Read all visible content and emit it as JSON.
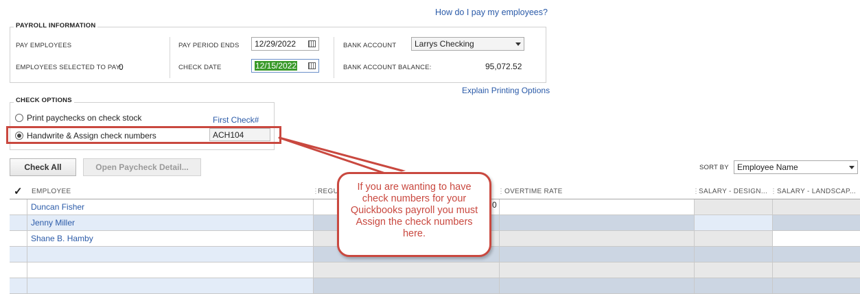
{
  "help_link": "How do I pay my employees?",
  "payroll_info": {
    "title": "PAYROLL INFORMATION",
    "pay_employees_label": "PAY EMPLOYEES",
    "employees_selected_label": "EMPLOYEES SELECTED TO PAY:",
    "employees_selected_value": "0",
    "pay_period_ends_label": "PAY PERIOD ENDS",
    "pay_period_ends_value": "12/29/2022",
    "check_date_label": "CHECK DATE",
    "check_date_value": "12/15/2022",
    "bank_account_label": "BANK ACCOUNT",
    "bank_account_value": "Larrys Checking",
    "bank_balance_label": "BANK ACCOUNT BALANCE:",
    "bank_balance_value": "95,072.52"
  },
  "explain_printing_link": "Explain Printing Options",
  "check_options": {
    "title": "CHECK OPTIONS",
    "print_option": "Print paychecks on check stock",
    "handwrite_option": "Handwrite & Assign check numbers",
    "selected": "handwrite",
    "first_check_label": "First Check#",
    "first_check_value": "ACH104"
  },
  "buttons": {
    "check_all": "Check All",
    "open_detail": "Open Paycheck Detail..."
  },
  "sort": {
    "label": "SORT BY",
    "value": "Employee Name"
  },
  "table": {
    "check_header": "✓",
    "columns": [
      "EMPLOYEE",
      "REGU",
      "OVERTIME RATE",
      "SALARY - DESIGN...",
      "SALARY - LANDSCAP..."
    ],
    "rows": [
      {
        "employee": "Duncan Fisher",
        "regular_partial": "0"
      },
      {
        "employee": "Jenny Miller",
        "regular_partial": ""
      },
      {
        "employee": "Shane B. Hamby",
        "regular_partial": ""
      },
      {
        "employee": "",
        "regular_partial": ""
      },
      {
        "employee": "",
        "regular_partial": ""
      },
      {
        "employee": "",
        "regular_partial": ""
      }
    ]
  },
  "callout": {
    "text": "If you are wanting to have check numbers for your Quickbooks payroll you must Assign the check numbers here."
  },
  "colors": {
    "link": "#2a5aa8",
    "callout_red": "#c9483f",
    "row_alt": "#e3ecf8",
    "cell_grey": "#e8e8e8",
    "cell_blue_grey": "#ccd6e3",
    "check_date_highlight": "#3a9a2a"
  }
}
